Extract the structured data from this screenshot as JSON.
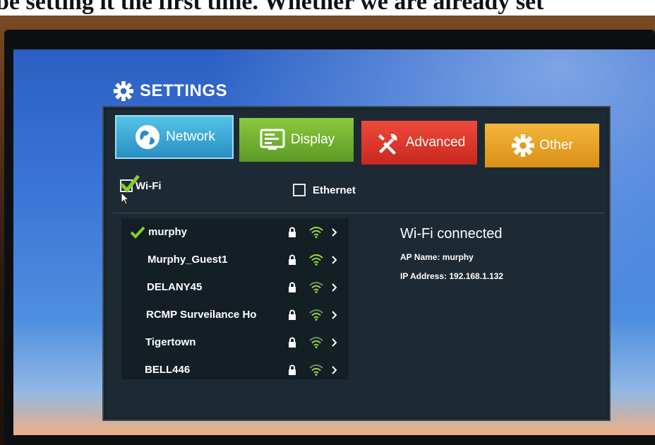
{
  "caption": "be setting it the first time. Whether we are already set",
  "settings": {
    "title": "SETTINGS",
    "icon": "gear-icon"
  },
  "tabs": [
    {
      "label": "Network",
      "icon": "globe-icon",
      "color": "#3aa9d8"
    },
    {
      "label": "Display",
      "icon": "display-icon",
      "color": "#78b534"
    },
    {
      "label": "Advanced",
      "icon": "tools-icon",
      "color": "#e0372c"
    },
    {
      "label": "Other",
      "icon": "gear-icon",
      "color": "#eba52a"
    }
  ],
  "connection": {
    "wifi_label": "Wi-Fi",
    "wifi_checked": true,
    "ethernet_label": "Ethernet",
    "ethernet_checked": false
  },
  "networks": [
    {
      "name": "murphy",
      "connected": true
    },
    {
      "name": "Murphy_Guest1",
      "connected": false
    },
    {
      "name": "DELANY45",
      "connected": false
    },
    {
      "name": "RCMP Surveilance Ho",
      "connected": false
    },
    {
      "name": "Tigertown",
      "connected": false
    },
    {
      "name": "BELL446",
      "connected": false
    }
  ],
  "status": {
    "title": "Wi-Fi connected",
    "ap_name": "AP Name:  murphy",
    "ip_address": "IP Address:  192.168.1.132"
  },
  "colors": {
    "check_green": "#7fd12a",
    "wifi_green": "#9ad83a",
    "panel": "#1d2a33"
  }
}
